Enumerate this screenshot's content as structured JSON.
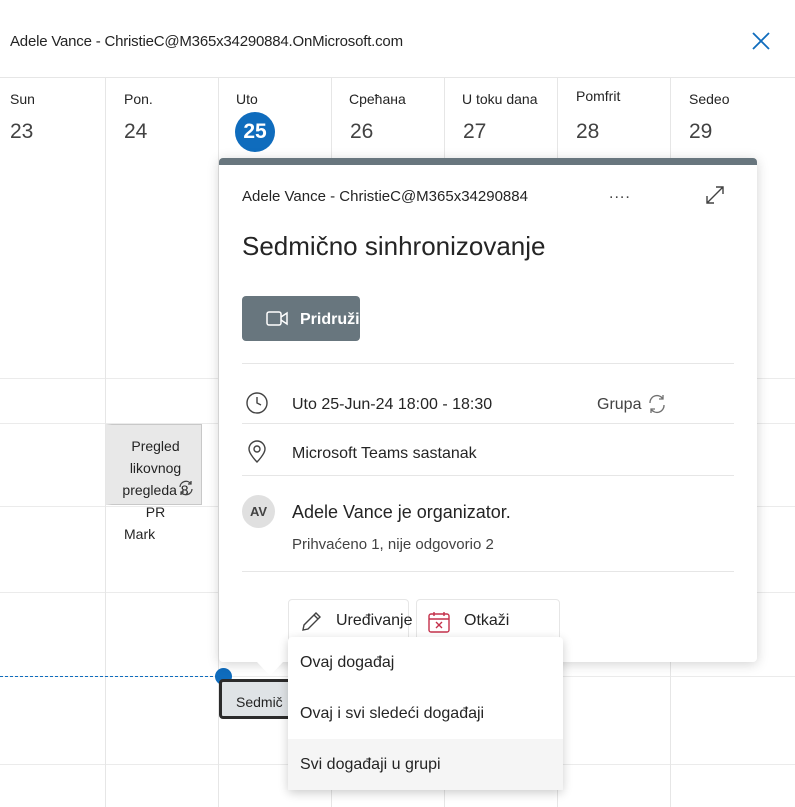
{
  "header": {
    "title": "Adele Vance - ChristieC@M365x34290884.OnMicrosoft.com",
    "close_icon": "close-icon"
  },
  "days": [
    {
      "name": "Sun",
      "num": "23"
    },
    {
      "name": "Pon.",
      "num": "24"
    },
    {
      "name": "Uto",
      "num": "25",
      "today": true
    },
    {
      "name": "Срећана",
      "num": "26"
    },
    {
      "name": "U toku dana",
      "num": "27"
    },
    {
      "name": "Pomfrit",
      "num": "28"
    },
    {
      "name": "Sedeo",
      "num": "29"
    }
  ],
  "calendar_event": {
    "line1": "Pregled likovnog",
    "line2": "pregleda 8 PR",
    "line3": "Mark",
    "icon": "repeat-icon"
  },
  "selected_event": {
    "label": "Sedmič"
  },
  "popup": {
    "calendar_name": "Adele Vance - ChristieC@M365x34290884",
    "more_label": "....",
    "title": "Sedmično sinhronizovanje",
    "join_label": "Pridruži",
    "datetime": "Uto 25-Jun-24 18:00 - 18:30",
    "series_label": "Grupa",
    "location": "Microsoft Teams sastanak",
    "avatar_initials": "AV",
    "organizer": "Adele Vance je organizator.",
    "attendees": "Prihvaćeno 1, nije odgovorio 2",
    "edit_label": "Uređivanje",
    "cancel_label": "Otkaži"
  },
  "dropdown": {
    "items": [
      "Ovaj događaj",
      "Ovaj i svi sledeći događaji",
      "Svi događaji u grupi"
    ]
  },
  "colors": {
    "accent": "#0f6cbd",
    "popup_header": "#68767e",
    "cancel_red": "#c4314b"
  }
}
